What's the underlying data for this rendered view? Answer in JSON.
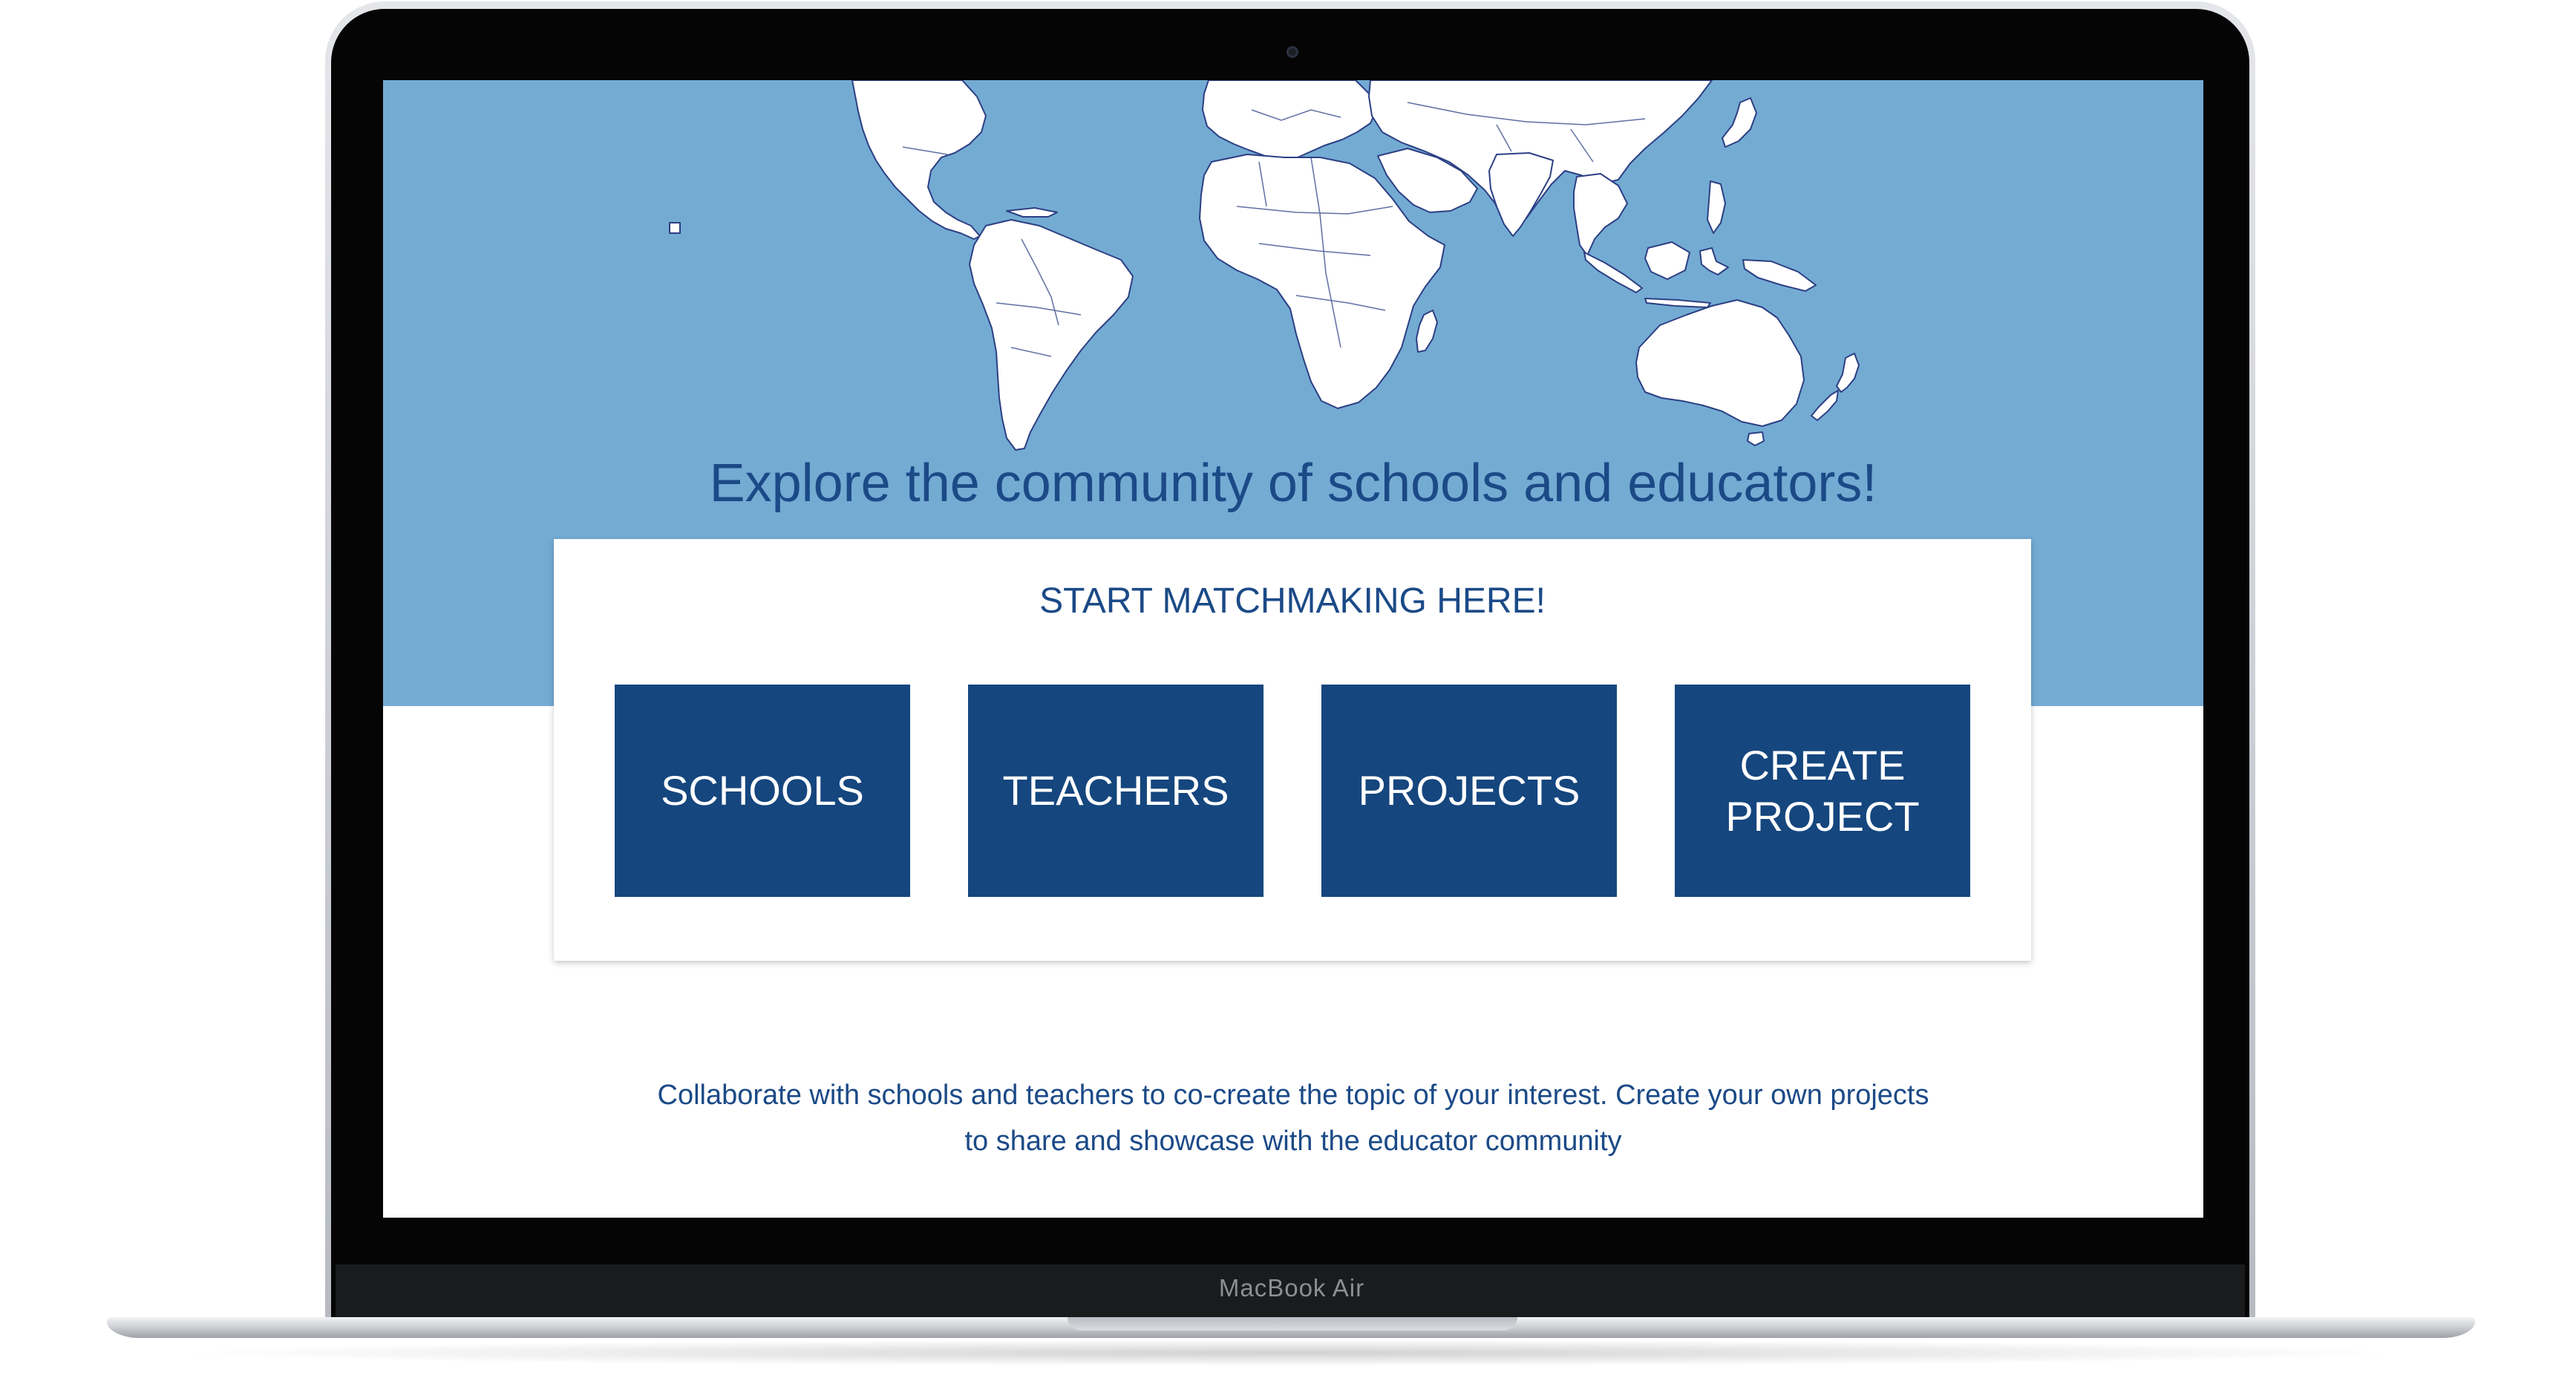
{
  "device": {
    "model_label": "MacBook Air"
  },
  "hero": {
    "title": "Explore the community of schools and educators!"
  },
  "matchmaking": {
    "heading": "START MATCHMAKING HERE!",
    "buttons": [
      {
        "label": "SCHOOLS"
      },
      {
        "label": "TEACHERS"
      },
      {
        "label": "PROJECTS"
      },
      {
        "label": "CREATE\nPROJECT"
      }
    ]
  },
  "description": {
    "line1": "Collaborate with schools and teachers to co-create the topic of your  interest. Create your own projects",
    "line2": "to share and showcase with the educator community"
  },
  "colors": {
    "hero_background": "#74abd3",
    "map_land": "#ffffff",
    "map_borders": "#2c3f84",
    "primary_blue": "#15467e",
    "text_blue": "#1b4a87",
    "screen_background": "#ffffff"
  }
}
